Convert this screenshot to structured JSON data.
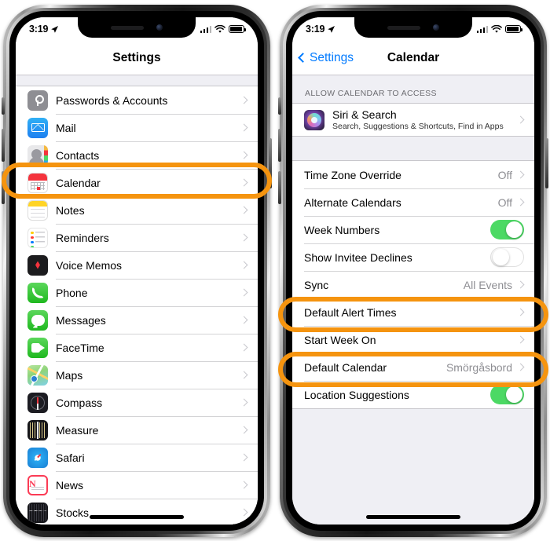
{
  "status_bar": {
    "time": "3:19",
    "location_arrow": "location-arrow",
    "signal": "cellular-bars",
    "wifi": "wifi-icon",
    "battery": "battery-icon"
  },
  "left_phone": {
    "nav": {
      "title": "Settings"
    },
    "items": [
      {
        "label": "Passwords & Accounts",
        "icon": "passwords-icon"
      },
      {
        "label": "Mail",
        "icon": "mail-icon"
      },
      {
        "label": "Contacts",
        "icon": "contacts-icon"
      },
      {
        "label": "Calendar",
        "icon": "calendar-icon",
        "highlighted": true
      },
      {
        "label": "Notes",
        "icon": "notes-icon"
      },
      {
        "label": "Reminders",
        "icon": "reminders-icon"
      },
      {
        "label": "Voice Memos",
        "icon": "voice-memos-icon"
      },
      {
        "label": "Phone",
        "icon": "phone-icon"
      },
      {
        "label": "Messages",
        "icon": "messages-icon"
      },
      {
        "label": "FaceTime",
        "icon": "facetime-icon"
      },
      {
        "label": "Maps",
        "icon": "maps-icon"
      },
      {
        "label": "Compass",
        "icon": "compass-icon"
      },
      {
        "label": "Measure",
        "icon": "measure-icon"
      },
      {
        "label": "Safari",
        "icon": "safari-icon"
      },
      {
        "label": "News",
        "icon": "news-icon"
      },
      {
        "label": "Stocks",
        "icon": "stocks-icon"
      }
    ]
  },
  "right_phone": {
    "nav": {
      "back_label": "Settings",
      "title": "Calendar"
    },
    "section_header": "ALLOW CALENDAR TO ACCESS",
    "siri_row": {
      "label": "Siri & Search",
      "sublabel": "Search, Suggestions & Shortcuts, Find in Apps",
      "icon": "siri-icon"
    },
    "settings_rows": [
      {
        "label": "Time Zone Override",
        "value": "Off",
        "type": "disclosure"
      },
      {
        "label": "Alternate Calendars",
        "value": "Off",
        "type": "disclosure"
      },
      {
        "label": "Week Numbers",
        "type": "toggle",
        "on": true
      },
      {
        "label": "Show Invitee Declines",
        "type": "toggle",
        "on": false
      },
      {
        "label": "Sync",
        "value": "All Events",
        "type": "disclosure"
      },
      {
        "label": "Default Alert Times",
        "value": "",
        "type": "disclosure",
        "highlighted": true
      },
      {
        "label": "Start Week On",
        "value": "",
        "type": "disclosure"
      },
      {
        "label": "Default Calendar",
        "value": "Smörgåsbord",
        "type": "disclosure",
        "highlighted": true
      },
      {
        "label": "Location Suggestions",
        "type": "toggle",
        "on": true
      }
    ]
  },
  "colors": {
    "highlight_orange": "#f5940f",
    "accent_blue": "#007aff",
    "toggle_green": "#4cd964",
    "value_gray": "#8e8e93"
  }
}
